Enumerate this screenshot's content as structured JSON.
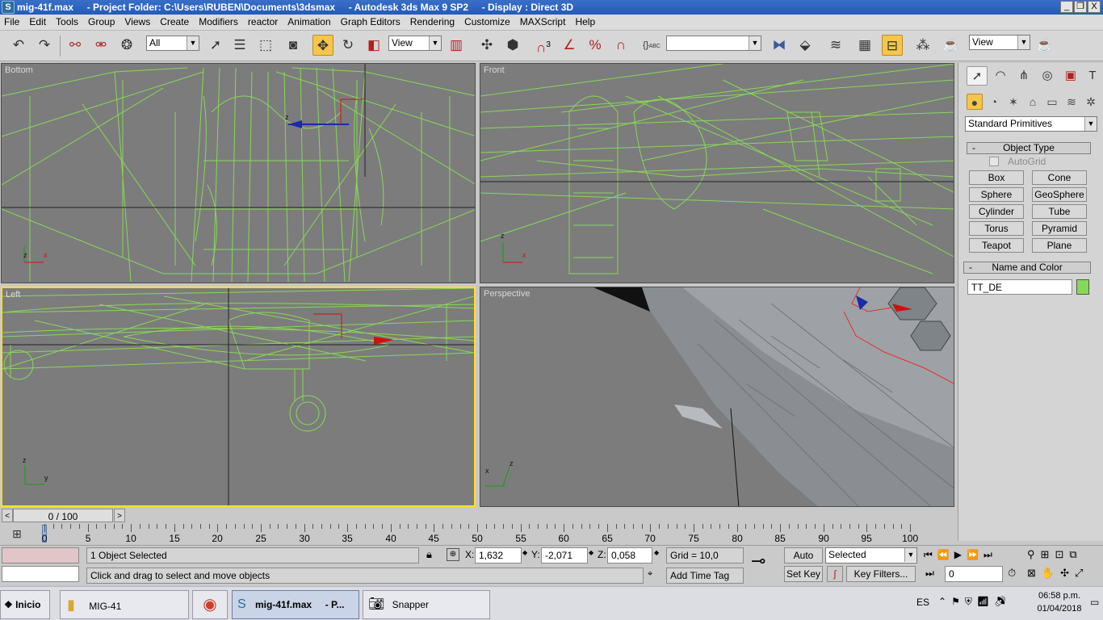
{
  "window": {
    "title": "mig-41f.max     - Project Folder: C:\\Users\\RUBEN\\Documents\\3dsmax     - Autodesk 3ds Max 9 SP2     - Display : Direct 3D",
    "btn_min": "_",
    "btn_restore": "❐",
    "btn_close": "X"
  },
  "menu": [
    "File",
    "Edit",
    "Tools",
    "Group",
    "Views",
    "Create",
    "Modifiers",
    "reactor",
    "Animation",
    "Graph Editors",
    "Rendering",
    "Customize",
    "MAXScript",
    "Help"
  ],
  "toolbar": {
    "selection_filter": "All",
    "ref_coord": "View",
    "named_sel": "",
    "view_dd": "View",
    "snap_label": "3",
    "percent": "%",
    "abc": "ABC"
  },
  "viewports": {
    "top_left": "Bottom",
    "top_right": "Front",
    "bottom_left": "Left",
    "bottom_right": "Perspective"
  },
  "axis": {
    "x": "x",
    "z": "z",
    "y": "y"
  },
  "command_panel": {
    "category_dropdown": "Standard Primitives",
    "object_type": {
      "header": "Object Type",
      "minus": "-",
      "autogrid": "AutoGrid",
      "buttons": [
        [
          "Box",
          "Cone"
        ],
        [
          "Sphere",
          "GeoSphere"
        ],
        [
          "Cylinder",
          "Tube"
        ],
        [
          "Torus",
          "Pyramid"
        ],
        [
          "Teapot",
          "Plane"
        ]
      ]
    },
    "name_color": {
      "header": "Name and Color",
      "minus": "-",
      "name": "TT_DE",
      "color": "#88d858"
    }
  },
  "timeline": {
    "frame_label": "0 / 100",
    "prev": "<",
    "next": ">",
    "ticks": [
      "0",
      "5",
      "10",
      "15",
      "20",
      "25",
      "30",
      "35",
      "40",
      "45",
      "50",
      "55",
      "60",
      "65",
      "70",
      "75",
      "80",
      "85",
      "90",
      "95",
      "100"
    ]
  },
  "status": {
    "selection": "1 Object Selected",
    "prompt": "Click and drag to select and move objects",
    "x_label": "X:",
    "x": "1,632",
    "y_label": "Y:",
    "y": "-2,071",
    "z_label": "Z:",
    "z": "0,058",
    "grid": "Grid = 10,0",
    "add_time_tag": "Add Time Tag",
    "auto_key": "Auto Key",
    "set_key": "Set Key",
    "key_mode": "Selected",
    "key_filters": "Key Filters...",
    "frame": "0"
  },
  "taskbar": {
    "start": "Inicio",
    "items": [
      "MIG-41",
      "",
      "mig-41f.max     - P...",
      "Snapper"
    ],
    "lang": "ES",
    "time": "06:58 p.m.",
    "date": "01/04/2018"
  },
  "colors": {
    "wire": "#88d858",
    "viewport_bg": "#7c7c7c",
    "active_border": "#ffe020",
    "titlebar": "#2d63bf",
    "highlight": "#f4c64a"
  }
}
